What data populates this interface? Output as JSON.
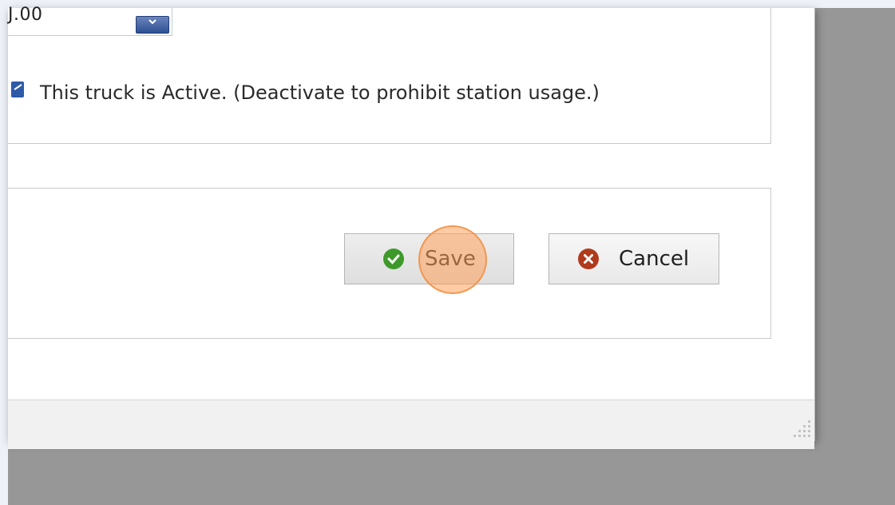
{
  "amount": {
    "value": "J.00"
  },
  "truck_status": {
    "checked": true,
    "label": "This truck is Active. (Deactivate to prohibit station usage.)"
  },
  "buttons": {
    "save_label": "Save",
    "cancel_label": "Cancel"
  },
  "icons": {
    "dropdown": "chevron-down-icon",
    "save": "checkmark-circle-icon",
    "cancel": "x-circle-icon",
    "resize": "resize-grip-icon"
  },
  "colors": {
    "save_icon": "#3d9a2a",
    "cancel_icon": "#b03b1c",
    "checkbox": "#2e5aa8",
    "click_marker": "#f6a15e"
  }
}
